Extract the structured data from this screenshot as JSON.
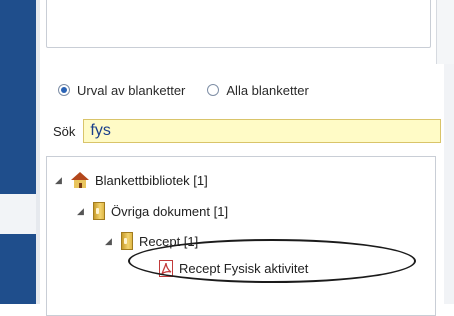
{
  "form": {
    "radio_selection": "Urval av blanketter",
    "radio_all": "Alla blanketter",
    "search_label": "Sök",
    "search_value": "fys"
  },
  "tree": {
    "root": "Blankettbibliotek [1]",
    "folder": "Övriga dokument [1]",
    "subfolder": "Recept [1]",
    "document": "Recept Fysisk aktivitet"
  },
  "icons": {
    "root": "library-home-icon",
    "folder": "binder-folder-icon",
    "subfolder": "binder-folder-icon",
    "document": "pdf-document-icon"
  },
  "colors": {
    "nav_bar": "#1f4e8c",
    "search_highlight": "#fffbc6",
    "radio_selected": "#2a63b5"
  }
}
